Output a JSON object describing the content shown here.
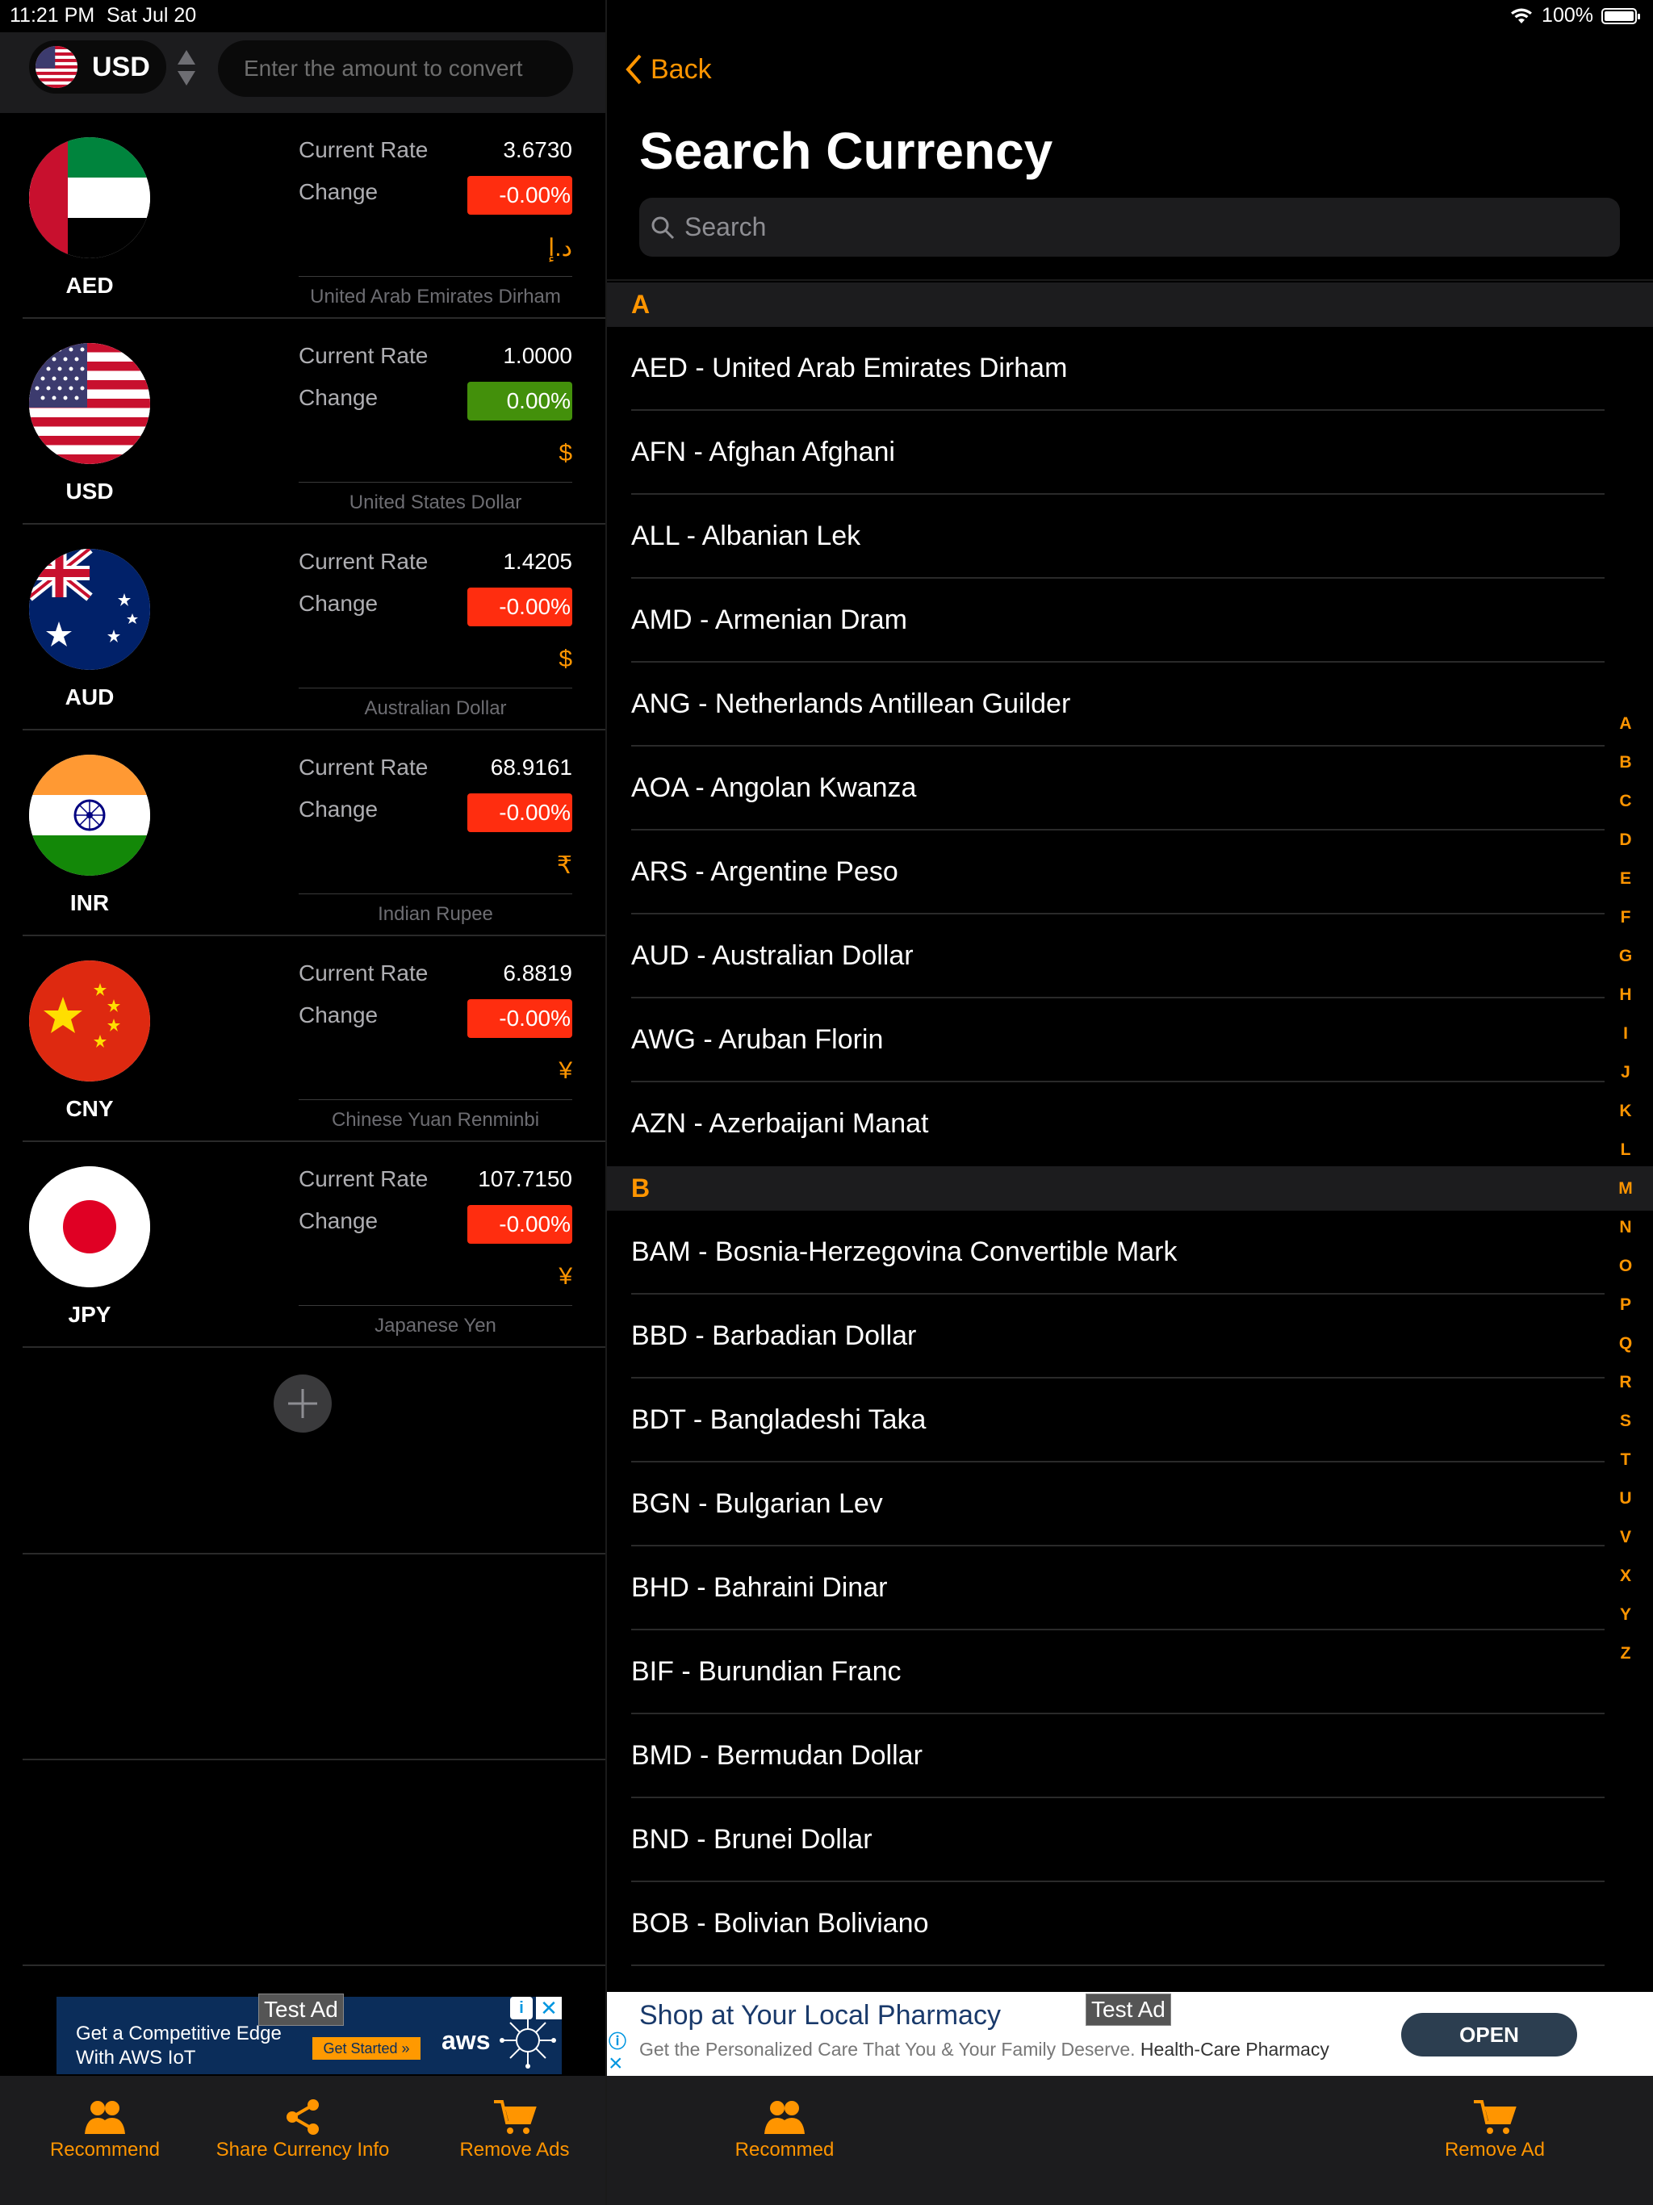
{
  "status": {
    "time": "11:21 PM",
    "date": "Sat Jul 20",
    "battery": "100%"
  },
  "converter": {
    "base_currency": "USD",
    "amount_placeholder": "Enter the amount to convert",
    "rate_label": "Current Rate",
    "change_label": "Change",
    "rows": [
      {
        "code": "AED",
        "flag": "ae-flag-icon",
        "rate": "3.6730",
        "change": "-0.00%",
        "trend": "neg",
        "symbol": "د.إ",
        "name": "United Arab Emirates Dirham"
      },
      {
        "code": "USD",
        "flag": "us-flag-icon",
        "rate": "1.0000",
        "change": "0.00%",
        "trend": "pos",
        "symbol": "$",
        "name": "United States Dollar"
      },
      {
        "code": "AUD",
        "flag": "au-flag-icon",
        "rate": "1.4205",
        "change": "-0.00%",
        "trend": "neg",
        "symbol": "$",
        "name": "Australian Dollar"
      },
      {
        "code": "INR",
        "flag": "in-flag-icon",
        "rate": "68.9161",
        "change": "-0.00%",
        "trend": "neg",
        "symbol": "₹",
        "name": "Indian Rupee"
      },
      {
        "code": "CNY",
        "flag": "cn-flag-icon",
        "rate": "6.8819",
        "change": "-0.00%",
        "trend": "neg",
        "symbol": "¥",
        "name": "Chinese Yuan Renminbi"
      },
      {
        "code": "JPY",
        "flag": "jp-flag-icon",
        "rate": "107.7150",
        "change": "-0.00%",
        "trend": "neg",
        "symbol": "¥",
        "name": "Japanese Yen"
      }
    ]
  },
  "left_ad": {
    "badge": "Test Ad",
    "line1": "Get a Competitive Edge",
    "line2": "With AWS IoT",
    "cta": "Get Started »",
    "brand": "aws"
  },
  "left_tabs": {
    "recommend": "Recommend",
    "share": "Share Currency Info",
    "remove_ads": "Remove Ads"
  },
  "search_panel": {
    "back": "Back",
    "title": "Search Currency",
    "search_placeholder": "Search",
    "sections": [
      {
        "letter": "A",
        "items": [
          "AED - United Arab Emirates Dirham",
          "AFN - Afghan Afghani",
          "ALL - Albanian Lek",
          "AMD - Armenian Dram",
          "ANG - Netherlands Antillean Guilder",
          "AOA - Angolan Kwanza",
          "ARS - Argentine Peso",
          "AUD - Australian Dollar",
          "AWG - Aruban Florin",
          "AZN - Azerbaijani Manat"
        ]
      },
      {
        "letter": "B",
        "items": [
          "BAM - Bosnia-Herzegovina Convertible Mark",
          "BBD - Barbadian Dollar",
          "BDT - Bangladeshi Taka",
          "BGN - Bulgarian Lev",
          "BHD - Bahraini Dinar",
          "BIF - Burundian Franc",
          "BMD - Bermudan Dollar",
          "BND - Brunei Dollar",
          "BOB - Bolivian Boliviano"
        ]
      }
    ],
    "index": [
      "A",
      "B",
      "C",
      "D",
      "E",
      "F",
      "G",
      "H",
      "I",
      "J",
      "K",
      "L",
      "M",
      "N",
      "O",
      "P",
      "Q",
      "R",
      "S",
      "T",
      "U",
      "V",
      "X",
      "Y",
      "Z"
    ]
  },
  "right_ad": {
    "badge": "Test Ad",
    "title": "Shop at Your Local Pharmacy",
    "subtitle": "Get the Personalized Care That You & Your Family Deserve.",
    "advertiser": "Health-Care Pharmacy",
    "cta": "OPEN"
  },
  "right_tabs": {
    "recommend": "Recommed",
    "remove_ads": "Remove Ad"
  },
  "colors": {
    "accent": "#ff9500",
    "negative": "#ff2d0f",
    "positive": "#43900b",
    "background": "#000000",
    "bar": "#1c1c1e"
  }
}
